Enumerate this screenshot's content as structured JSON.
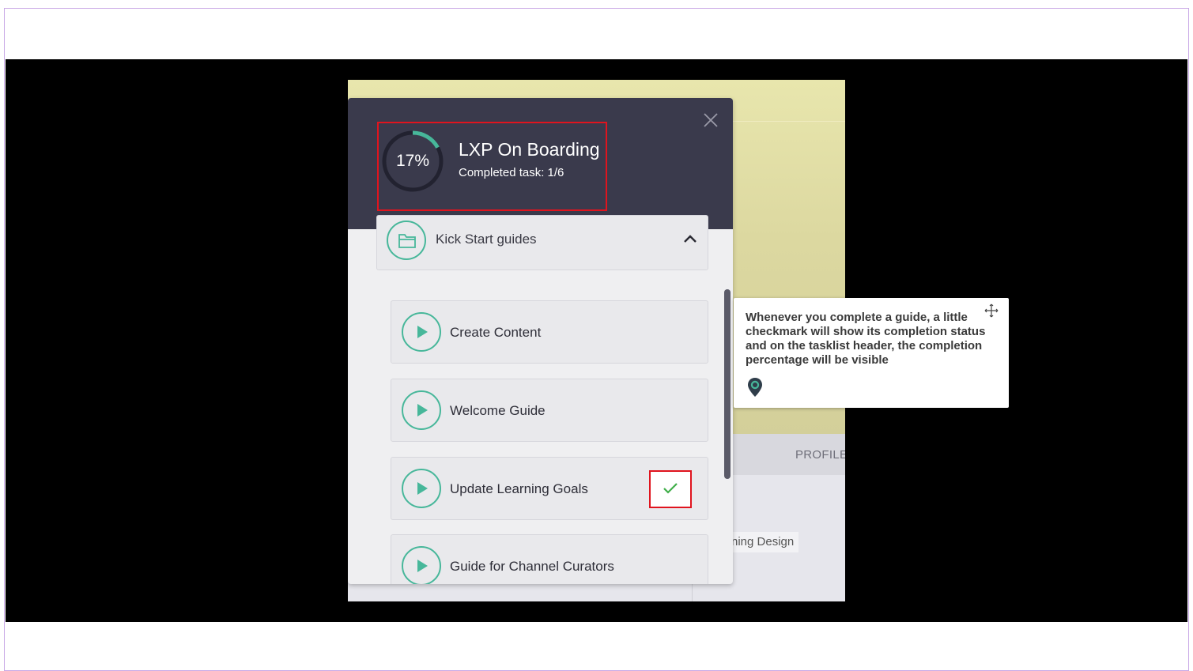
{
  "panel": {
    "progress_percent": 17,
    "progress_label": "17%",
    "title": "LXP On Boarding",
    "subtitle": "Completed task: 1/6",
    "section": {
      "label": "Kick Start guides",
      "expanded": true
    },
    "tasks": [
      {
        "label": "Create Content",
        "completed": false
      },
      {
        "label": "Welcome Guide",
        "completed": false
      },
      {
        "label": "Update Learning Goals",
        "completed": true
      },
      {
        "label": "Guide for Channel Curators",
        "completed": false
      }
    ]
  },
  "background_app": {
    "tab_label": "PROFILE",
    "chip_text": "ning Design"
  },
  "tooltip": {
    "text": "Whenever you complete a guide, a little checkmark will show its completion status and on the tasklist header, the completion percentage will be visible"
  },
  "icons": {
    "close": "close-icon",
    "section": "folder-icon",
    "collapse": "chevron-up-icon",
    "task": "play-icon",
    "done": "checkmark-icon",
    "move": "move-icon",
    "brand": "map-pin-icon"
  },
  "colors": {
    "header_bg": "#3a3a4c",
    "accent": "#47b79a",
    "highlight": "#e0141e",
    "check": "#3fae49"
  }
}
